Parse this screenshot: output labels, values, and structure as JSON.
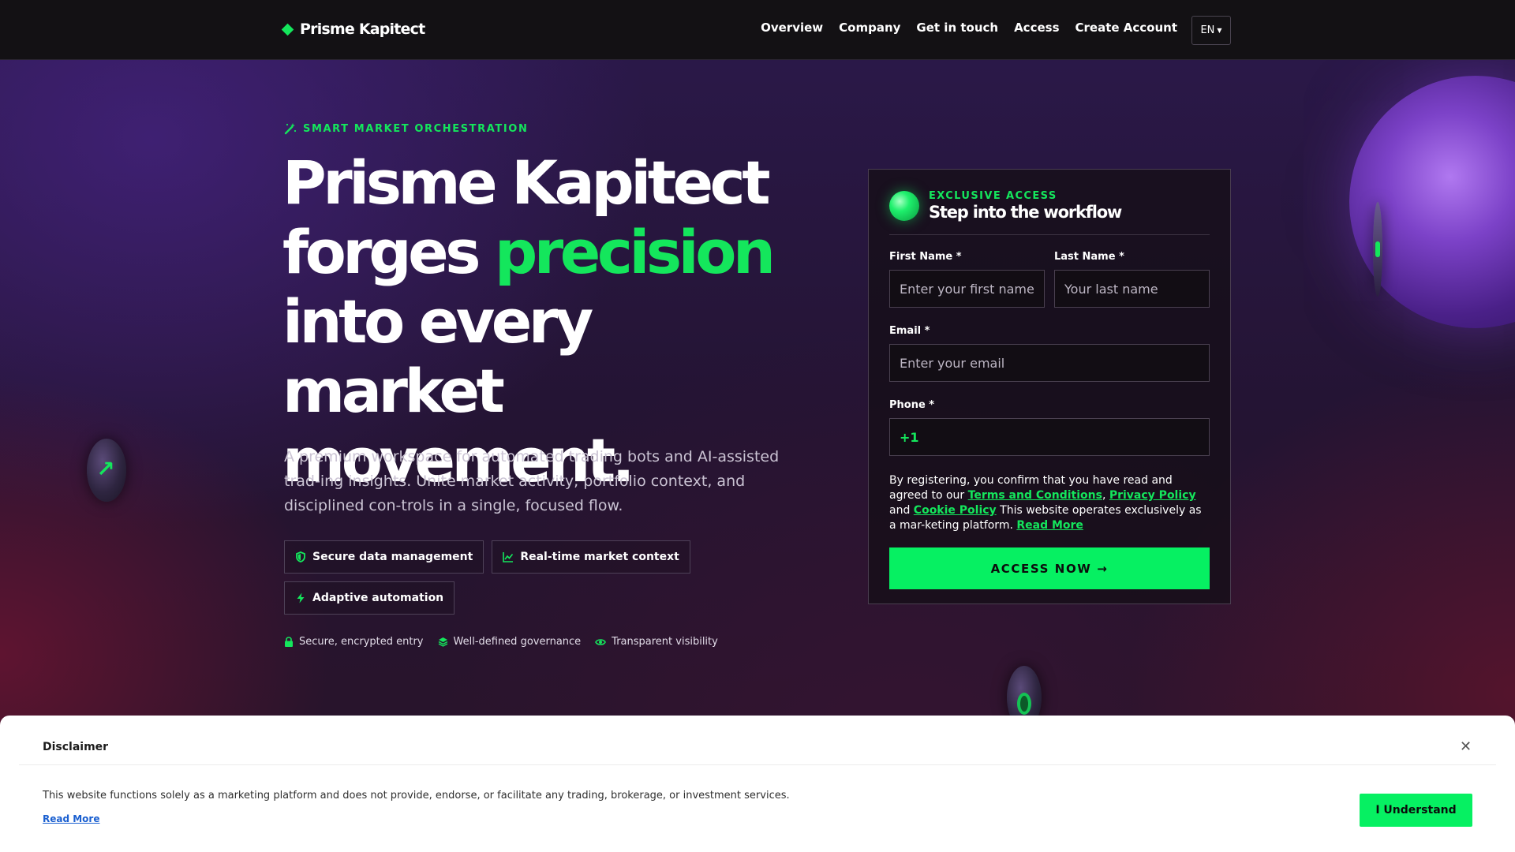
{
  "header": {
    "logo_text": "Prisme Kapitect",
    "nav": [
      "Overview",
      "Company",
      "Get in touch",
      "Access",
      "Create Account"
    ],
    "language": "EN"
  },
  "hero": {
    "eyebrow": "SMART MARKET ORCHESTRATION",
    "headline_line1": "Prisme Kapitect",
    "headline_forges": "forges ",
    "headline_accent": "precision",
    "headline_line3": "into every market",
    "headline_line4": "movement.",
    "lede": "A premium workspace for automated trading bots and AI-assisted trad-ing insights. Unite market activity, portfolio context, and disciplined con-trols in a single, focused flow.",
    "chips": [
      "Secure data management",
      "Real-time market context",
      "Adaptive automation"
    ],
    "trust": [
      "Secure, encrypted entry",
      "Well-defined governance",
      "Transparent visibility"
    ]
  },
  "form": {
    "eyebrow": "EXCLUSIVE ACCESS",
    "title": "Step into the workflow",
    "first_name_label": "First Name *",
    "first_name_placeholder": "Enter your first name",
    "last_name_label": "Last Name *",
    "last_name_placeholder": "Your last name",
    "email_label": "Email *",
    "email_placeholder": "Enter your email",
    "phone_label": "Phone *",
    "phone_prefix": "+1",
    "consent_prefix": "By registering, you confirm that you have read and agreed to our ",
    "terms": "Terms and Conditions",
    "comma": ", ",
    "privacy": "Privacy Policy",
    "and": " and ",
    "cookie": "Cookie Policy",
    "consent_suffix": " This website operates exclusively as a mar-keting platform. ",
    "read_more": "Read More",
    "submit": "ACCESS NOW →"
  },
  "disclaimer": {
    "title": "Disclaimer",
    "body": "This website functions solely as a marketing platform and does not provide, endorse, or facilitate any trading, brokerage, or investment services.",
    "read_more": "Read More",
    "button": "I Understand"
  },
  "colors": {
    "accent": "#14e65c",
    "header_bg": "#131114",
    "cta": "#06f062"
  },
  "icons": {
    "logo": "diamond-icon",
    "eyebrow": "magic-wand-icon",
    "chips": [
      "shield-icon",
      "line-chart-icon",
      "lightning-icon"
    ],
    "trust": [
      "lock-icon",
      "layers-icon",
      "eye-icon"
    ],
    "close": "close-icon"
  }
}
